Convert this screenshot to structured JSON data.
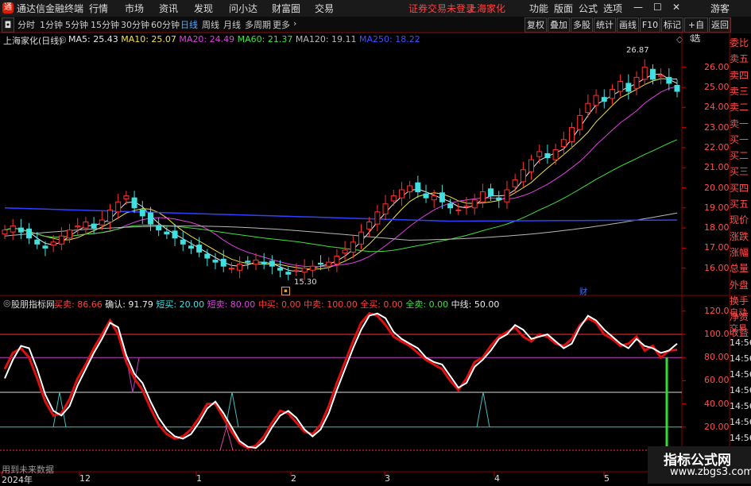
{
  "app": {
    "logo_text": "通",
    "title": "通达信金融终端",
    "menus": [
      "行情",
      "市场",
      "资讯",
      "发现",
      "问小达",
      "财富圈",
      "交易"
    ],
    "notice": "证券交易未登录",
    "stock_link": "上海家化",
    "right_menus": [
      "功能",
      "版面",
      "公式",
      "选项"
    ],
    "tourist": "游客",
    "win_min": "—",
    "win_max": "☐",
    "win_close": "✕"
  },
  "toolbar": {
    "periods": [
      "分时",
      "1分钟",
      "5分钟",
      "15分钟",
      "30分钟",
      "60分钟",
      "日线",
      "周线",
      "月线",
      "多周期",
      "更多"
    ],
    "selected": "日线",
    "buttons": [
      "复权",
      "叠加",
      "多股",
      "统计",
      "画线",
      "F10",
      "标记",
      "+自选",
      "返回"
    ]
  },
  "main_info": {
    "stock": "上海家化(日线)",
    "ma": [
      {
        "label": "MA5: 25.43",
        "color": "#e8e8e8"
      },
      {
        "label": "MA10: 25.07",
        "color": "#f0e040"
      },
      {
        "label": "MA20: 24.49",
        "color": "#e040e0"
      },
      {
        "label": "MA60: 21.37",
        "color": "#40e040"
      },
      {
        "label": "MA120: 19.11",
        "color": "#b8b8b8"
      },
      {
        "label": "MA250: 18.22",
        "color": "#4050ff"
      }
    ],
    "high_label": "26.87",
    "low_label": "15.30",
    "finance_mark": "财"
  },
  "price_axis": [
    "26.00",
    "25.00",
    "24.00",
    "23.00",
    "22.00",
    "21.00",
    "20.00",
    "19.00",
    "18.00",
    "17.00",
    "16.00"
  ],
  "sub_info": {
    "name": "股朋指标网",
    "items": [
      {
        "label": "买卖: 86.66",
        "color": "#ff4040"
      },
      {
        "label": "确认: 91.79",
        "color": "#e8e8e8"
      },
      {
        "label": "短买: 20.00",
        "color": "#40e0e0"
      },
      {
        "label": "短卖: 80.00",
        "color": "#e040e0"
      },
      {
        "label": "中买: 0.00",
        "color": "#ff4040"
      },
      {
        "label": "中卖: 100.00",
        "color": "#ff4040"
      },
      {
        "label": "全买: 0.00",
        "color": "#ff4040"
      },
      {
        "label": "全卖: 0.00",
        "color": "#40e040"
      },
      {
        "label": "中线: 50.00",
        "color": "#e8e8e8"
      }
    ],
    "footnote": "用到未来数据"
  },
  "sub_axis": [
    "120.0",
    "100.0",
    "80.00",
    "60.00",
    "40.00",
    "20.00"
  ],
  "date_axis": [
    "2024年",
    "12",
    "1",
    "2",
    "3",
    "4",
    "5"
  ],
  "side_panel": {
    "top": [
      "委比",
      "卖五",
      "卖四",
      "卖三",
      "卖二",
      "卖一",
      "买一",
      "买二",
      "买三",
      "买四",
      "买五",
      "现价",
      "涨跌",
      "涨幅",
      "总量",
      "外盘",
      "换手",
      "净资",
      "收益"
    ],
    "bottom": [
      "自动",
      "交易",
      "14:56",
      "14:56",
      "14:56",
      "14:56",
      "14:56",
      "14:56",
      "14:56",
      "14:56",
      "14:56"
    ]
  },
  "watermark": {
    "title": "指标公式网",
    "url": "www.zbgs3.com"
  },
  "chart_data": [
    {
      "type": "candlestick",
      "title": "上海家化(日线)",
      "ylim": [
        15.3,
        26.87
      ],
      "close": [
        17.9,
        18.1,
        17.8,
        17.5,
        17.2,
        17.0,
        17.3,
        17.6,
        17.9,
        18.1,
        18.3,
        18.0,
        18.4,
        18.9,
        19.3,
        19.6,
        19.0,
        18.6,
        18.2,
        17.9,
        17.7,
        17.5,
        17.2,
        17.0,
        16.8,
        16.5,
        16.3,
        16.1,
        16.0,
        16.2,
        16.3,
        16.4,
        16.2,
        16.1,
        15.9,
        15.7,
        15.9,
        16.0,
        16.1,
        16.2,
        16.3,
        16.6,
        16.9,
        17.3,
        17.8,
        18.3,
        18.8,
        19.2,
        19.6,
        19.9,
        20.1,
        19.8,
        19.5,
        19.6,
        19.3,
        19.0,
        18.9,
        19.1,
        19.4,
        19.8,
        19.6,
        19.4,
        19.9,
        20.4,
        20.9,
        21.4,
        21.8,
        21.5,
        21.9,
        22.4,
        23.0,
        23.6,
        24.2,
        24.6,
        24.3,
        24.9,
        25.3,
        24.8,
        25.5,
        26.0,
        25.4,
        25.6,
        25.2,
        24.8
      ]
    },
    {
      "type": "line",
      "title": "股朋指标网",
      "ylim": [
        0,
        120
      ],
      "series": [
        {
          "name": "确认",
          "values": [
            62,
            78,
            90,
            88,
            70,
            48,
            34,
            30,
            38,
            56,
            70,
            84,
            96,
            110,
            106,
            82,
            66,
            58,
            42,
            28,
            18,
            12,
            10,
            14,
            24,
            36,
            42,
            32,
            20,
            8,
            3,
            2,
            8,
            20,
            30,
            34,
            28,
            18,
            12,
            18,
            32,
            52,
            70,
            88,
            104,
            116,
            118,
            114,
            102,
            96,
            92,
            88,
            80,
            76,
            74,
            64,
            54,
            58,
            72,
            78,
            86,
            96,
            100,
            108,
            104,
            96,
            98,
            100,
            94,
            88,
            92,
            106,
            116,
            112,
            104,
            98,
            92,
            88,
            96,
            90,
            88,
            84,
            86,
            92
          ]
        },
        {
          "name": "买卖",
          "values": [
            70,
            84,
            88,
            80,
            62,
            42,
            30,
            32,
            44,
            62,
            74,
            88,
            100,
            112,
            100,
            76,
            62,
            52,
            36,
            22,
            14,
            10,
            12,
            18,
            28,
            40,
            40,
            28,
            16,
            6,
            2,
            4,
            12,
            24,
            34,
            32,
            24,
            16,
            14,
            22,
            38,
            58,
            76,
            94,
            110,
            118,
            116,
            108,
            98,
            94,
            90,
            84,
            78,
            74,
            70,
            60,
            52,
            62,
            76,
            80,
            90,
            98,
            102,
            106,
            98,
            94,
            100,
            98,
            92,
            90,
            96,
            108,
            114,
            110,
            100,
            96,
            90,
            92,
            98,
            86,
            90,
            80,
            86,
            86.66
          ]
        }
      ],
      "levels": {
        "中卖": 100,
        "短卖": 80,
        "中线": 50,
        "短买": 20,
        "中买": 0
      }
    }
  ]
}
